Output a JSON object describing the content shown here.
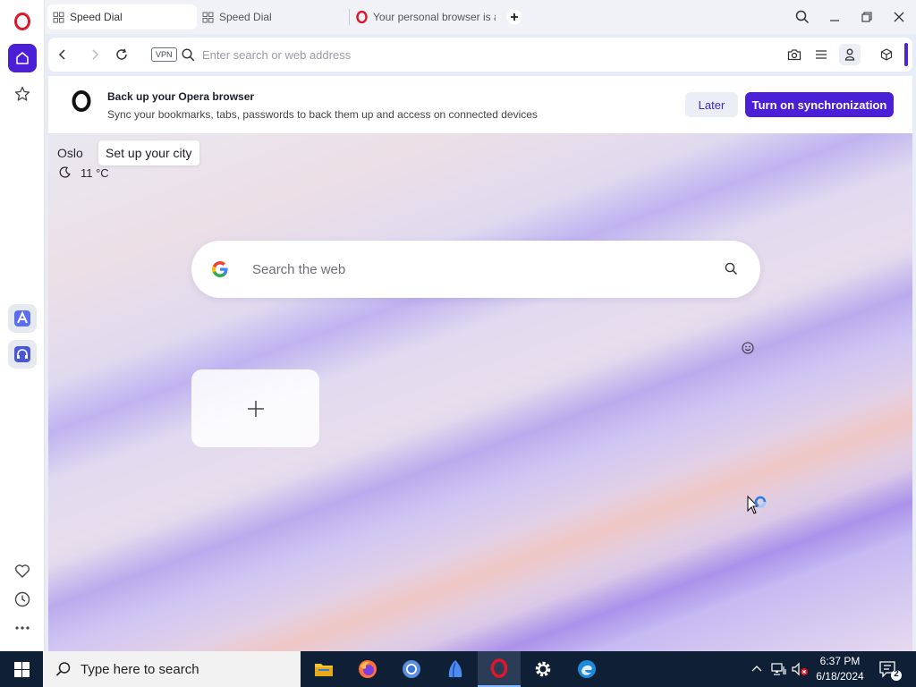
{
  "tabs": [
    {
      "title": "Speed Dial",
      "active": true
    },
    {
      "title": "Speed Dial",
      "active": false
    },
    {
      "title": "Your personal browser is a",
      "active": false
    }
  ],
  "address_bar": {
    "vpn_label": "VPN",
    "placeholder": "Enter search or web address",
    "value": ""
  },
  "banner": {
    "title": "Back up your Opera browser",
    "subtitle": "Sync your bookmarks, tabs, passwords to back them up and access on connected devices",
    "later_label": "Later",
    "sync_label": "Turn on synchronization"
  },
  "weather": {
    "city": "Oslo",
    "tooltip": "Set up your city",
    "temperature": "11 °C"
  },
  "search": {
    "placeholder": "Search the web",
    "value": ""
  },
  "taskbar": {
    "search_placeholder": "Type here to search",
    "time": "6:37 PM",
    "date": "6/18/2024",
    "notification_count": "2"
  },
  "colors": {
    "accent": "#4a1fd6",
    "opera_red": "#e0162b",
    "taskbar": "#0f1f35"
  }
}
